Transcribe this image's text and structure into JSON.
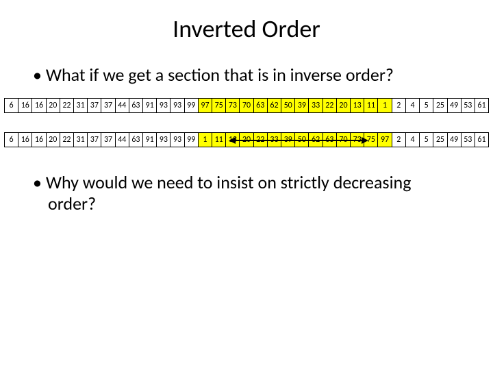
{
  "title": "Inverted Order",
  "bullet1": "What if we get a section that is in inverse order?",
  "bullet2": "Why would we need to insist on strictly decreasing order?",
  "row1": {
    "cells": [
      {
        "v": "6",
        "hl": false
      },
      {
        "v": "16",
        "hl": false
      },
      {
        "v": "16",
        "hl": false
      },
      {
        "v": "20",
        "hl": false
      },
      {
        "v": "22",
        "hl": false
      },
      {
        "v": "31",
        "hl": false
      },
      {
        "v": "37",
        "hl": false
      },
      {
        "v": "37",
        "hl": false
      },
      {
        "v": "44",
        "hl": false
      },
      {
        "v": "63",
        "hl": false
      },
      {
        "v": "91",
        "hl": false
      },
      {
        "v": "93",
        "hl": false
      },
      {
        "v": "93",
        "hl": false
      },
      {
        "v": "99",
        "hl": false
      },
      {
        "v": "97",
        "hl": true
      },
      {
        "v": "75",
        "hl": true
      },
      {
        "v": "73",
        "hl": true
      },
      {
        "v": "70",
        "hl": true
      },
      {
        "v": "63",
        "hl": true
      },
      {
        "v": "62",
        "hl": true
      },
      {
        "v": "50",
        "hl": true
      },
      {
        "v": "39",
        "hl": true
      },
      {
        "v": "33",
        "hl": true
      },
      {
        "v": "22",
        "hl": true
      },
      {
        "v": "20",
        "hl": true
      },
      {
        "v": "13",
        "hl": true
      },
      {
        "v": "11",
        "hl": true
      },
      {
        "v": "1",
        "hl": true
      },
      {
        "v": "2",
        "hl": false
      },
      {
        "v": "4",
        "hl": false
      },
      {
        "v": "5",
        "hl": false
      },
      {
        "v": "25",
        "hl": false
      },
      {
        "v": "49",
        "hl": false
      },
      {
        "v": "53",
        "hl": false
      },
      {
        "v": "61",
        "hl": false
      }
    ]
  },
  "row2": {
    "cells": [
      {
        "v": "6",
        "hl": false
      },
      {
        "v": "16",
        "hl": false
      },
      {
        "v": "16",
        "hl": false
      },
      {
        "v": "20",
        "hl": false
      },
      {
        "v": "22",
        "hl": false
      },
      {
        "v": "31",
        "hl": false
      },
      {
        "v": "37",
        "hl": false
      },
      {
        "v": "37",
        "hl": false
      },
      {
        "v": "44",
        "hl": false
      },
      {
        "v": "63",
        "hl": false
      },
      {
        "v": "91",
        "hl": false
      },
      {
        "v": "93",
        "hl": false
      },
      {
        "v": "93",
        "hl": false
      },
      {
        "v": "99",
        "hl": false
      },
      {
        "v": "1",
        "hl": true
      },
      {
        "v": "11",
        "hl": true
      },
      {
        "v": "13",
        "hl": true
      },
      {
        "v": "20",
        "hl": true
      },
      {
        "v": "22",
        "hl": true
      },
      {
        "v": "33",
        "hl": true
      },
      {
        "v": "39",
        "hl": true
      },
      {
        "v": "50",
        "hl": true
      },
      {
        "v": "62",
        "hl": true
      },
      {
        "v": "63",
        "hl": true
      },
      {
        "v": "70",
        "hl": true
      },
      {
        "v": "73",
        "hl": true
      },
      {
        "v": "75",
        "hl": true
      },
      {
        "v": "97",
        "hl": true
      },
      {
        "v": "2",
        "hl": false
      },
      {
        "v": "4",
        "hl": false
      },
      {
        "v": "5",
        "hl": false
      },
      {
        "v": "25",
        "hl": false
      },
      {
        "v": "49",
        "hl": false
      },
      {
        "v": "53",
        "hl": false
      },
      {
        "v": "61",
        "hl": false
      }
    ]
  }
}
